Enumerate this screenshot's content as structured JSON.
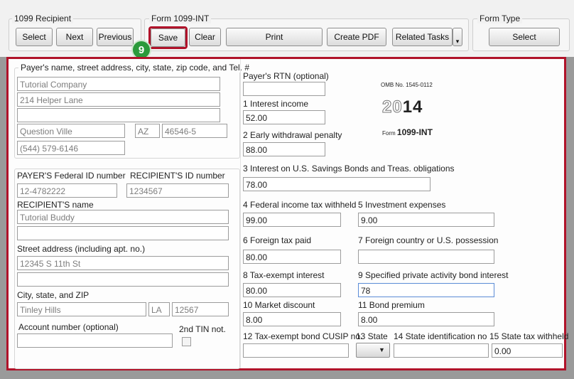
{
  "recipient_group": {
    "legend": "1099 Recipient",
    "select": "Select",
    "next": "Next",
    "previous": "Previous"
  },
  "form_group": {
    "legend": "Form 1099-INT",
    "save": "Save",
    "clear": "Clear",
    "print": "Print",
    "create_pdf": "Create PDF",
    "related_tasks": "Related Tasks"
  },
  "form_type_group": {
    "legend": "Form Type",
    "select": "Select"
  },
  "step_badge": "9",
  "payer": {
    "legend": "Payer's name, street address, city, state, zip code, and Tel. #",
    "name": "Tutorial Company",
    "street": "214 Helper Lane",
    "line3": "",
    "city": "Question Ville",
    "state": "AZ",
    "zip": "46546-5",
    "phone": "(544) 579-6146"
  },
  "ids": {
    "payer_id_label": "PAYER'S Federal ID number",
    "payer_id": "12-4782222",
    "recipient_id_label": "RECIPIENT'S ID number",
    "recipient_id": "1234567",
    "recipient_name_label": "RECIPIENT'S name",
    "recipient_name": "Tutorial Buddy",
    "recipient_name2": "",
    "street_label": "Street address (including apt. no.)",
    "street": "12345 S 11th St",
    "street2": "",
    "city_label": "City, state, and ZIP",
    "city": "Tinley Hills",
    "state": "LA",
    "zip": "12567",
    "account_label": "Account number (optional)",
    "account": "",
    "tin_label": "2nd TIN not."
  },
  "form": {
    "rtn_label": "Payer's RTN (optional)",
    "rtn": "",
    "omb": "OMB No. 1545-0112",
    "year_light": "20",
    "year_bold": "14",
    "form_prefix": "Form",
    "form_name": "1099-INT",
    "box1_label": "1 Interest income",
    "box1": "52.00",
    "box2_label": "2 Early withdrawal penalty",
    "box2": "88.00",
    "box3_label": "3 Interest on U.S. Savings Bonds and Treas. obligations",
    "box3": "78.00",
    "box4_label": "4 Federal income tax withheld",
    "box4": "99.00",
    "box5_label": "5 Investment expenses",
    "box5": "9.00",
    "box6_label": "6 Foreign tax paid",
    "box6": "80.00",
    "box7_label": "7 Foreign country or U.S. possession",
    "box7": "",
    "box8_label": "8 Tax-exempt interest",
    "box8": "80.00",
    "box9_label": "9 Specified private activity bond interest",
    "box9": "78",
    "box10_label": "10 Market discount",
    "box10": "8.00",
    "box11_label": "11 Bond premium",
    "box11": "8.00",
    "box12_label": "12 Tax-exempt bond CUSIP no.",
    "box12": "",
    "box13_label": "13 State",
    "box14_label": "14 State identification no",
    "box14": "",
    "box15_label": "15 State tax withheld",
    "box15": "0.00"
  }
}
